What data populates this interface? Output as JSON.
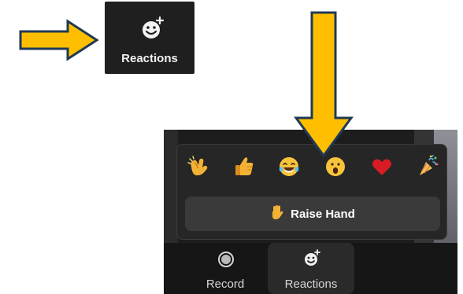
{
  "top_crop": {
    "button_label": "Reactions",
    "icon_name": "reactions-smiley-plus-icon"
  },
  "popup": {
    "reactions": [
      {
        "icon": "clap-icon"
      },
      {
        "icon": "thumbs-up-icon"
      },
      {
        "icon": "laugh-tears-icon"
      },
      {
        "icon": "surprised-icon"
      },
      {
        "icon": "heart-icon"
      },
      {
        "icon": "party-popper-icon"
      }
    ],
    "raise_hand_label": "Raise Hand"
  },
  "toolbar": {
    "record_label": "Record",
    "reactions_label": "Reactions"
  },
  "colors": {
    "arrow_fill": "#ffbf00",
    "arrow_stroke": "#1f3a55",
    "popup_bg": "#262626",
    "toolbar_bg": "#161616",
    "active_button_bg": "#2a2a2a"
  }
}
